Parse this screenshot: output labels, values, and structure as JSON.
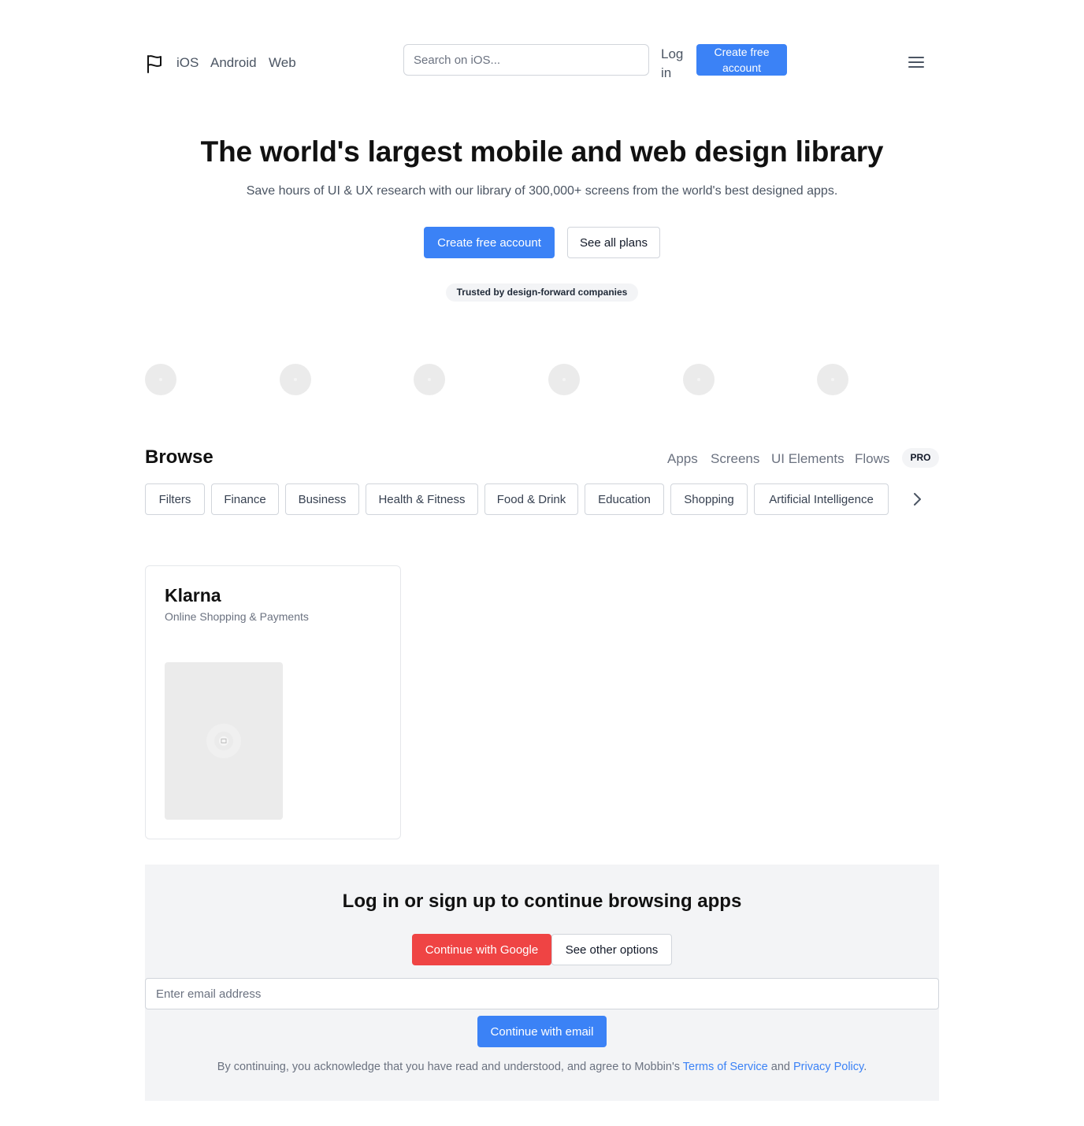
{
  "header": {
    "nav": [
      "iOS",
      "Android",
      "Web"
    ],
    "search_placeholder": "Search on iOS...",
    "login": "Log in",
    "cta": "Create free account"
  },
  "hero": {
    "title": "The world's largest mobile and web design library",
    "subtitle": "Save hours of UI & UX research with our library of 300,000+ screens from the world's best designed apps.",
    "primary_button": "Create free account",
    "secondary_button": "See all plans",
    "trusted_badge": "Trusted by design-forward companies"
  },
  "browse": {
    "title": "Browse",
    "tabs": [
      "Apps",
      "Screens",
      "UI Elements",
      "Flows"
    ],
    "pro_badge": "PRO",
    "chips": [
      "Filters",
      "Finance",
      "Business",
      "Health & Fitness",
      "Food & Drink",
      "Education",
      "Shopping",
      "Artificial Intelligence"
    ]
  },
  "app_card": {
    "name": "Klarna",
    "category": "Online Shopping & Payments"
  },
  "signup": {
    "title": "Log in or sign up to continue browsing apps",
    "google_button": "Continue with Google",
    "other_button": "See other options",
    "email_placeholder": "Enter email address",
    "email_button": "Continue with email",
    "legal_prefix": "By continuing, you acknowledge that you have read and understood, and agree to Mobbin's",
    "terms_link": "Terms of Service",
    "legal_and": "and",
    "privacy_link": "Privacy Policy",
    "legal_suffix": "."
  },
  "colors": {
    "accent": "#3b82f6",
    "google": "#ef4444",
    "band_bg": "#f3f4f6"
  },
  "icons": [
    "flag-logo-icon",
    "hamburger-menu-icon",
    "chevron-right-icon",
    "image-placeholder-icon"
  ]
}
